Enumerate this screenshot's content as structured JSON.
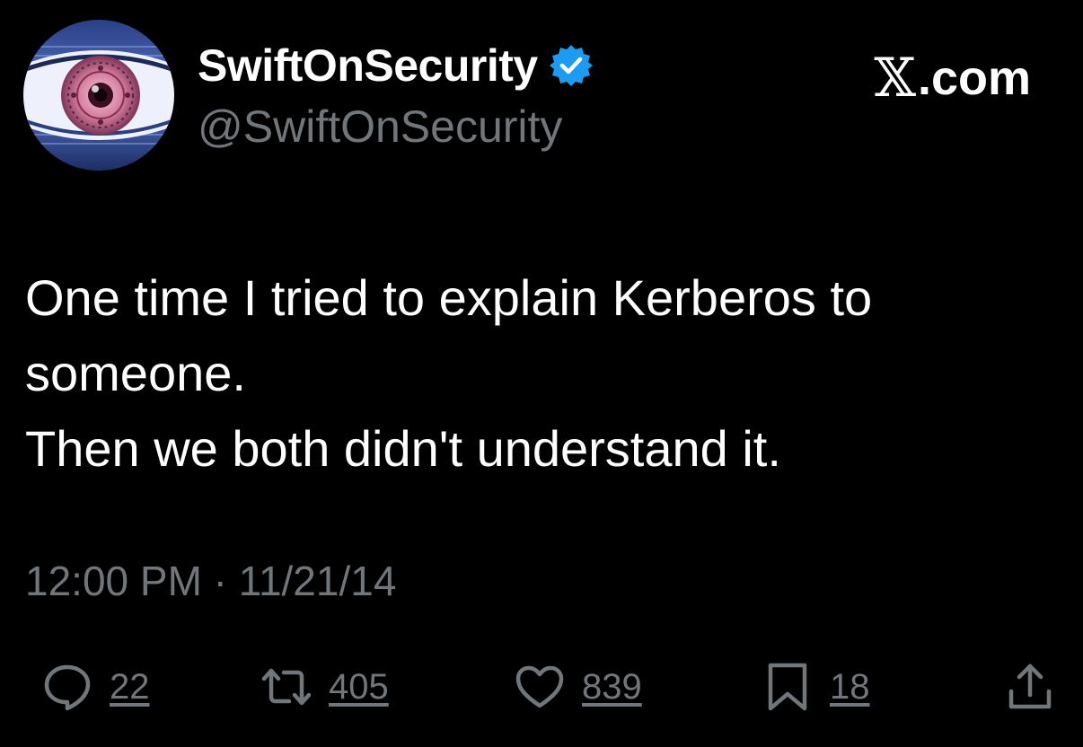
{
  "author": {
    "display_name": "SwiftOnSecurity",
    "handle": "@SwiftOnSecurity",
    "verified_icon": "verified-badge-icon"
  },
  "brand": {
    "text": ".com",
    "logo_icon": "x-logo-icon"
  },
  "tweet": {
    "lines": [
      "One time I tried to explain Kerberos to",
      "someone.",
      "Then we both didn't understand it."
    ],
    "timestamp": "12:00 PM · 11/21/14"
  },
  "actions": {
    "replies": "22",
    "retweets": "405",
    "likes": "839",
    "bookmarks": "18"
  },
  "colors": {
    "background": "#000000",
    "primary_text": "#ffffff",
    "secondary_text": "#71767b",
    "verified": "#1d9bf0"
  }
}
